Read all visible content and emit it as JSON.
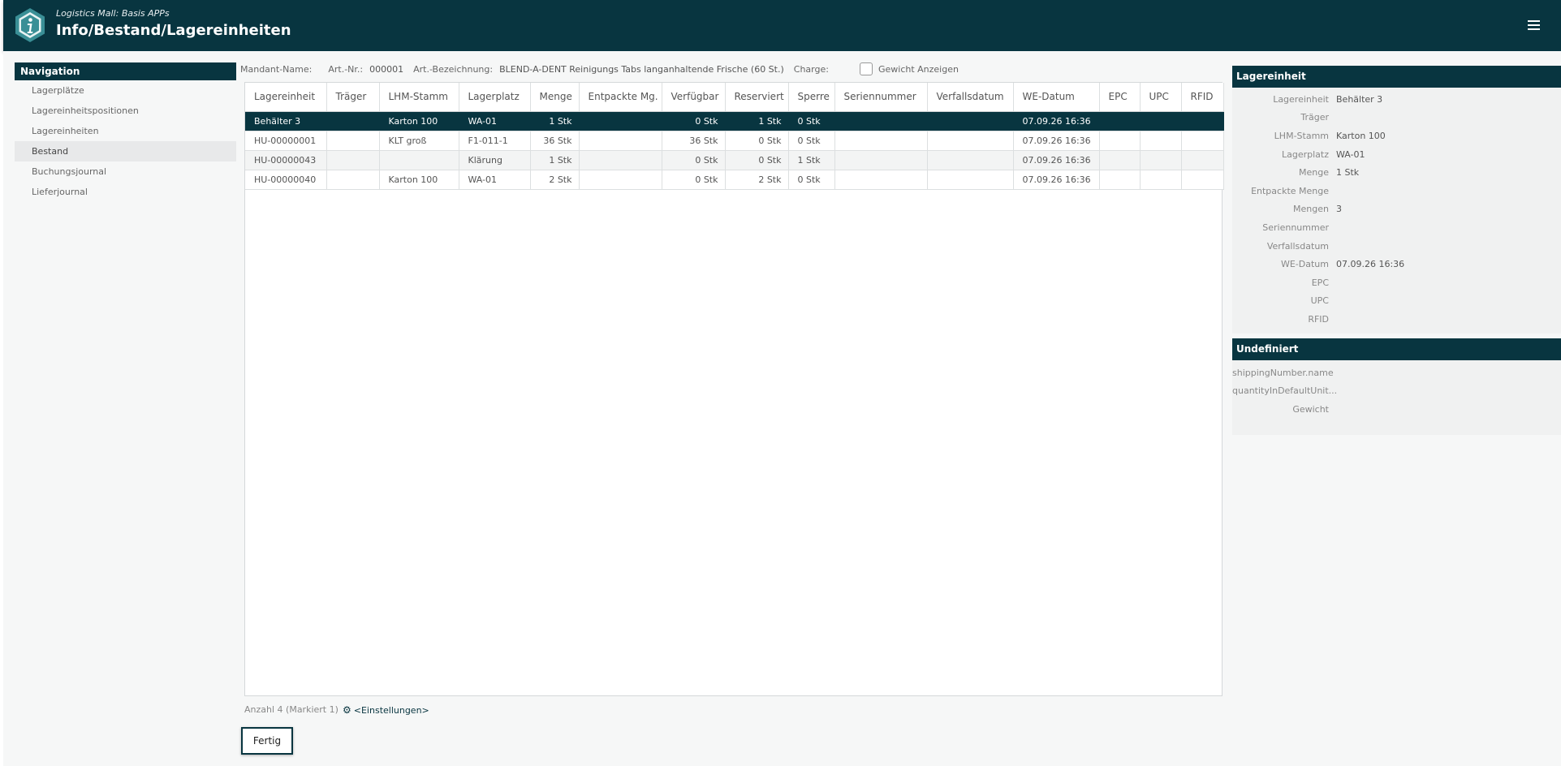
{
  "header": {
    "subtitle": "Logistics Mall: Basis APPs",
    "title": "Info/Bestand/Lagereinheiten",
    "logo_icon": "info-hexagon-icon",
    "menu_icon": "hamburger-menu-icon"
  },
  "colors": {
    "primary": "#083540",
    "row_alt": "#f3f4f4",
    "nav_active": "#e8e9ea"
  },
  "navigation": {
    "title": "Navigation",
    "items": [
      {
        "label": "Lagerplätze"
      },
      {
        "label": "Lagereinheitspositionen"
      },
      {
        "label": "Lagereinheiten"
      },
      {
        "label": "Bestand",
        "active": true
      },
      {
        "label": "Buchungsjournal"
      },
      {
        "label": "Lieferjournal"
      }
    ]
  },
  "info": {
    "mandant_label": "Mandant-Name:",
    "mandant_value": "",
    "artnr_label": "Art.-Nr.:",
    "artnr_value": "000001",
    "bez_label": "Art.-Bezeichnung:",
    "bez_value": "BLEND-A-DENT Reinigungs Tabs langanhaltende Frische (60 St.)",
    "charge_label": "Charge:",
    "charge_value": "",
    "gewicht_label": "Gewicht Anzeigen",
    "gewicht_checked": false
  },
  "table": {
    "columns": [
      "Lagereinheit",
      "Träger",
      "LHM-Stamm",
      "Lagerplatz",
      "Menge",
      "Entpackte Mg.",
      "Verfügbar",
      "Reserviert",
      "Sperre",
      "Seriennummer",
      "Verfallsdatum",
      "WE-Datum",
      "EPC",
      "UPC",
      "RFID"
    ],
    "rows": [
      [
        "Behälter 3",
        "",
        "Karton 100",
        "WA-01",
        "1 Stk",
        "",
        "0 Stk",
        "1 Stk",
        "0 Stk",
        "",
        "",
        "07.09.26 16:36",
        "",
        "",
        ""
      ],
      [
        "HU-00000001",
        "",
        "KLT groß",
        "F1-011-1",
        "36 Stk",
        "",
        "36 Stk",
        "0 Stk",
        "0 Stk",
        "",
        "",
        "07.09.26 16:36",
        "",
        "",
        ""
      ],
      [
        "HU-00000043",
        "",
        "",
        "Klärung",
        "1 Stk",
        "",
        "0 Stk",
        "0 Stk",
        "1 Stk",
        "",
        "",
        "07.09.26 16:36",
        "",
        "",
        ""
      ],
      [
        "HU-00000040",
        "",
        "Karton 100",
        "WA-01",
        "2 Stk",
        "",
        "0 Stk",
        "2 Stk",
        "0 Stk",
        "",
        "",
        "07.09.26 16:36",
        "",
        "",
        ""
      ]
    ],
    "selected_row": 0
  },
  "footer": {
    "count_text": "Anzahl 4 (Markiert 1)",
    "settings_label": "<Einstellungen>",
    "done_label": "Fertig"
  },
  "panels": {
    "lagereinheit": {
      "title": "Lagereinheit",
      "props": [
        {
          "key": "Lagereinheit",
          "value": "Behälter 3"
        },
        {
          "key": "Träger",
          "value": ""
        },
        {
          "key": "LHM-Stamm",
          "value": "Karton 100"
        },
        {
          "key": "Lagerplatz",
          "value": "WA-01"
        },
        {
          "key": "Menge",
          "value": "1 Stk"
        },
        {
          "key": "Entpackte Menge",
          "value": ""
        },
        {
          "key": "Mengen",
          "value": "3"
        },
        {
          "key": "Seriennummer",
          "value": ""
        },
        {
          "key": "Verfallsdatum",
          "value": ""
        },
        {
          "key": "WE-Datum",
          "value": "07.09.26 16:36"
        },
        {
          "key": "EPC",
          "value": ""
        },
        {
          "key": "UPC",
          "value": ""
        },
        {
          "key": "RFID",
          "value": ""
        }
      ]
    },
    "undefiniert": {
      "title": "Undefiniert",
      "props": [
        {
          "key": "shippingNumber.name",
          "value": ""
        },
        {
          "key": "quantityInDefaultUnit...",
          "value": ""
        },
        {
          "key": "Gewicht",
          "value": ""
        }
      ]
    }
  }
}
